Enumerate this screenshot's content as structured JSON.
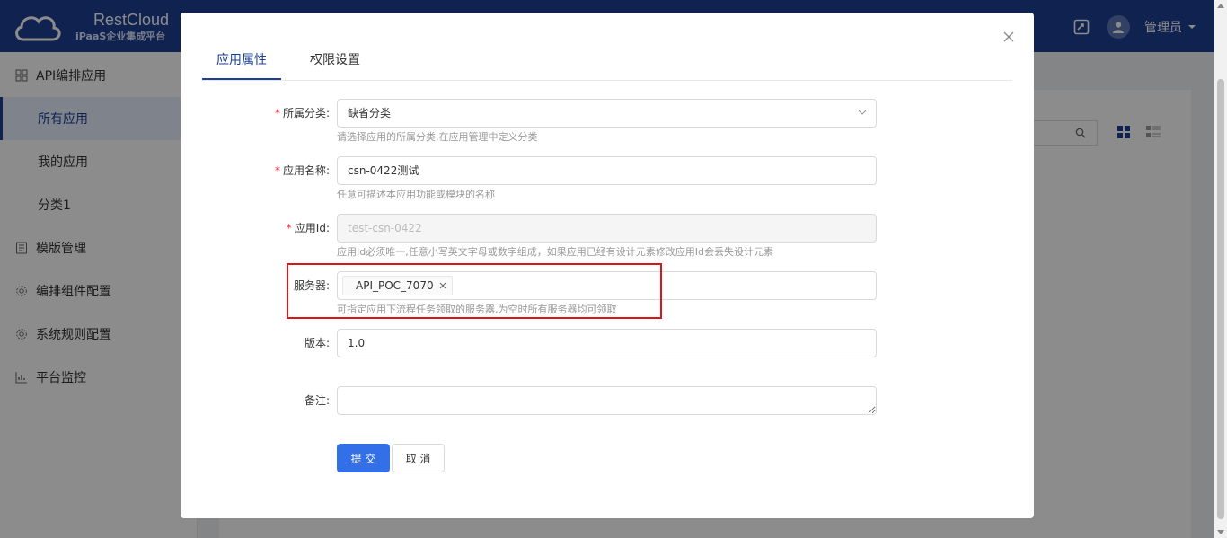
{
  "header": {
    "logo_title": "RestCloud",
    "logo_sub": "iPaaS企业集成平台",
    "user_name": "管理员",
    "brand_color": "#1d3f93"
  },
  "sidebar": {
    "items": [
      {
        "label": "API编排应用",
        "icon": "grid-icon"
      },
      {
        "label": "所有应用",
        "active": true
      },
      {
        "label": "我的应用"
      },
      {
        "label": "分类1"
      },
      {
        "label": "模版管理",
        "icon": "file-icon"
      },
      {
        "label": "编排组件配置",
        "icon": "gear-icon"
      },
      {
        "label": "系统规则配置",
        "icon": "gear-icon"
      },
      {
        "label": "平台监控",
        "icon": "chart-icon"
      }
    ]
  },
  "modal": {
    "tabs": [
      {
        "label": "应用属性",
        "active": true
      },
      {
        "label": "权限设置"
      }
    ],
    "fields": {
      "category": {
        "label": "所属分类:",
        "value": "缺省分类",
        "help": "请选择应用的所属分类,在应用管理中定义分类"
      },
      "app_name": {
        "label": "应用名称:",
        "value": "csn-0422测试",
        "help": "任意可描述本应用功能或模块的名称"
      },
      "app_id": {
        "label": "应用Id:",
        "value": "test-csn-0422",
        "help": "应用Id必须唯一,任意小写英文字母或数字组成，如果应用已经有设计元素修改应用Id会丢失设计元素"
      },
      "server": {
        "label": "服务器:",
        "tag": "API_POC_7070",
        "help": "可指定应用下流程任务领取的服务器,为空时所有服务器均可领取"
      },
      "version": {
        "label": "版本:",
        "value": "1.0"
      },
      "remark": {
        "label": "备注:",
        "value": ""
      }
    },
    "submit_label": "提 交",
    "cancel_label": "取 消",
    "required_mark": "*",
    "primary_color": "#3370e8",
    "highlight_color": "#d9161b"
  }
}
